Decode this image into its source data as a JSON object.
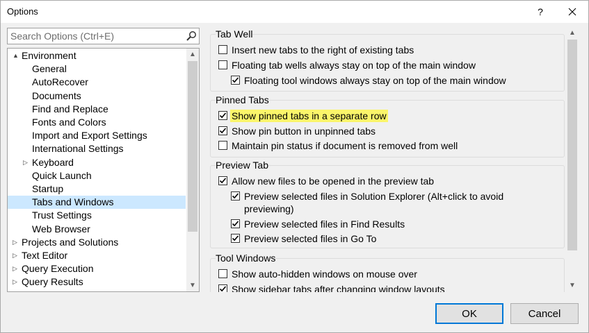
{
  "window": {
    "title": "Options",
    "help_glyph": "?"
  },
  "search": {
    "placeholder": "Search Options (Ctrl+E)"
  },
  "tree": [
    {
      "label": "Environment",
      "level": 0,
      "arrow": "▲"
    },
    {
      "label": "General",
      "level": 1,
      "arrow": ""
    },
    {
      "label": "AutoRecover",
      "level": 1,
      "arrow": ""
    },
    {
      "label": "Documents",
      "level": 1,
      "arrow": ""
    },
    {
      "label": "Find and Replace",
      "level": 1,
      "arrow": ""
    },
    {
      "label": "Fonts and Colors",
      "level": 1,
      "arrow": ""
    },
    {
      "label": "Import and Export Settings",
      "level": 1,
      "arrow": ""
    },
    {
      "label": "International Settings",
      "level": 1,
      "arrow": ""
    },
    {
      "label": "Keyboard",
      "level": 1,
      "arrow": "▷"
    },
    {
      "label": "Quick Launch",
      "level": 1,
      "arrow": ""
    },
    {
      "label": "Startup",
      "level": 1,
      "arrow": ""
    },
    {
      "label": "Tabs and Windows",
      "level": 1,
      "arrow": "",
      "selected": true
    },
    {
      "label": "Trust Settings",
      "level": 1,
      "arrow": ""
    },
    {
      "label": "Web Browser",
      "level": 1,
      "arrow": ""
    },
    {
      "label": "Projects and Solutions",
      "level": 0,
      "arrow": "▷"
    },
    {
      "label": "Text Editor",
      "level": 0,
      "arrow": "▷"
    },
    {
      "label": "Query Execution",
      "level": 0,
      "arrow": "▷"
    },
    {
      "label": "Query Results",
      "level": 0,
      "arrow": "▷"
    }
  ],
  "groups": [
    {
      "title": "Tab Well",
      "options": [
        {
          "label": "Insert new tabs to the right of existing tabs",
          "checked": false,
          "indent": 0
        },
        {
          "label": "Floating tab wells always stay on top of the main window",
          "checked": false,
          "indent": 0
        },
        {
          "label": "Floating tool windows always stay on top of the main window",
          "checked": true,
          "indent": 1
        }
      ]
    },
    {
      "title": "Pinned Tabs",
      "options": [
        {
          "label": "Show pinned tabs in a separate row",
          "checked": true,
          "indent": 0,
          "highlight": true
        },
        {
          "label": "Show pin button in unpinned tabs",
          "checked": true,
          "indent": 0
        },
        {
          "label": "Maintain pin status if document is removed from well",
          "checked": false,
          "indent": 0
        }
      ]
    },
    {
      "title": "Preview Tab",
      "options": [
        {
          "label": "Allow new files to be opened in the preview tab",
          "checked": true,
          "indent": 0
        },
        {
          "label": "Preview selected files in Solution Explorer (Alt+click to avoid",
          "label2": "previewing)",
          "checked": true,
          "indent": 1
        },
        {
          "label": "Preview selected files in Find Results",
          "checked": true,
          "indent": 1
        },
        {
          "label": "Preview selected files in Go To",
          "checked": true,
          "indent": 1
        }
      ]
    },
    {
      "title": "Tool Windows",
      "options": [
        {
          "label": "Show auto-hidden windows on mouse over",
          "checked": false,
          "indent": 0
        },
        {
          "label": "Show sidebar tabs after changing window layouts",
          "checked": true,
          "indent": 0
        }
      ]
    }
  ],
  "buttons": {
    "ok": "OK",
    "cancel": "Cancel"
  },
  "colors": {
    "highlight": "#fbf56a",
    "selection": "#cce8ff",
    "default_button_border": "#0078d7"
  }
}
